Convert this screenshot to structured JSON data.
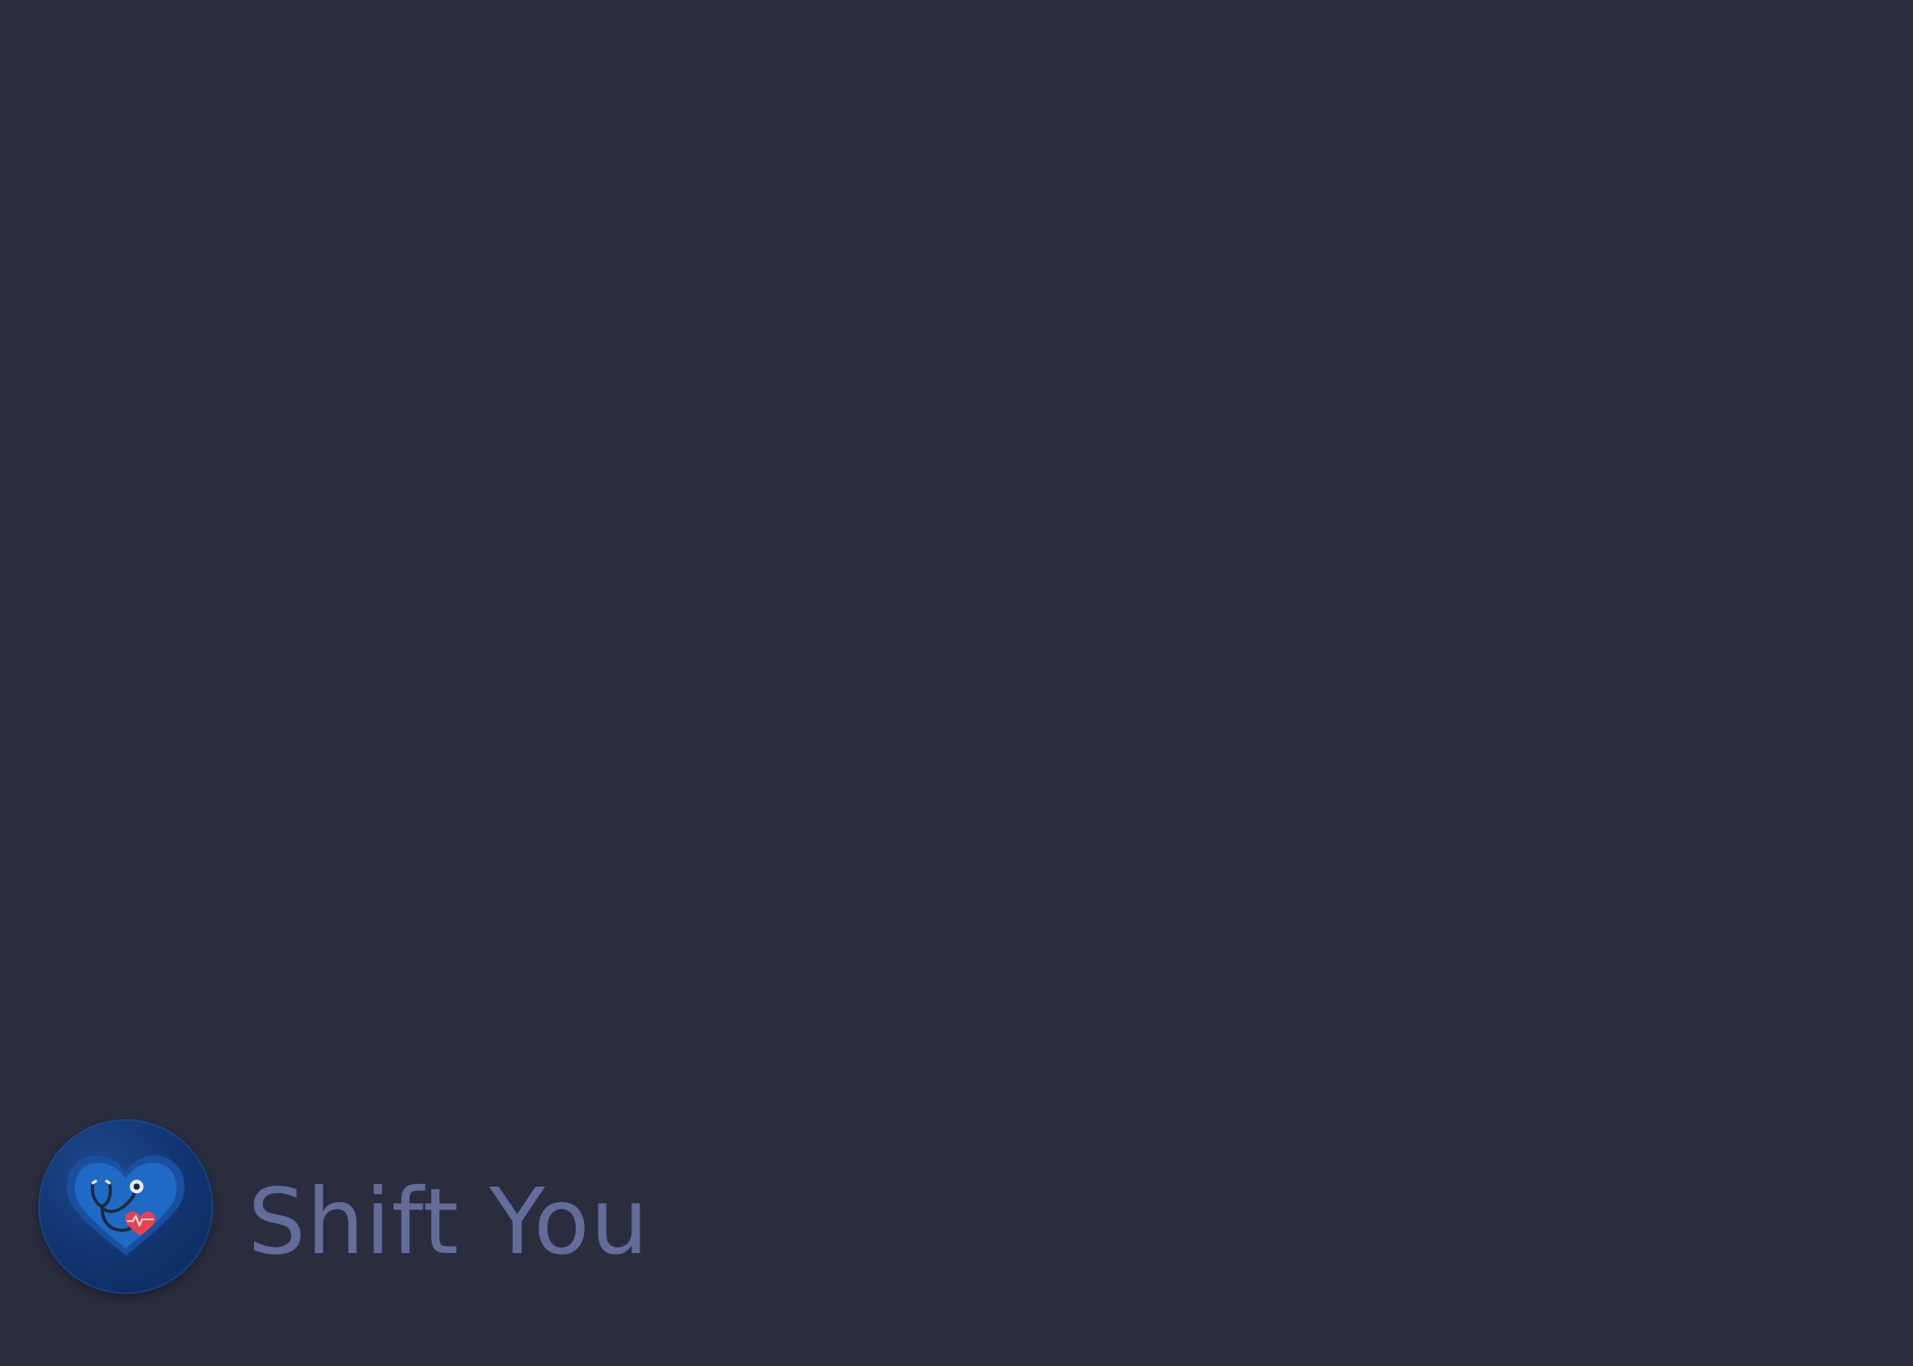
{
  "app": {
    "name": "Shift You",
    "logo_icon": "heart-stethoscope-icon"
  },
  "colors": {
    "background": "#2a2d3e",
    "title_text": "#626d99",
    "logo_circle": "#123673",
    "logo_heart": "#1f6ac4",
    "accent_heart": "#e9414f"
  }
}
